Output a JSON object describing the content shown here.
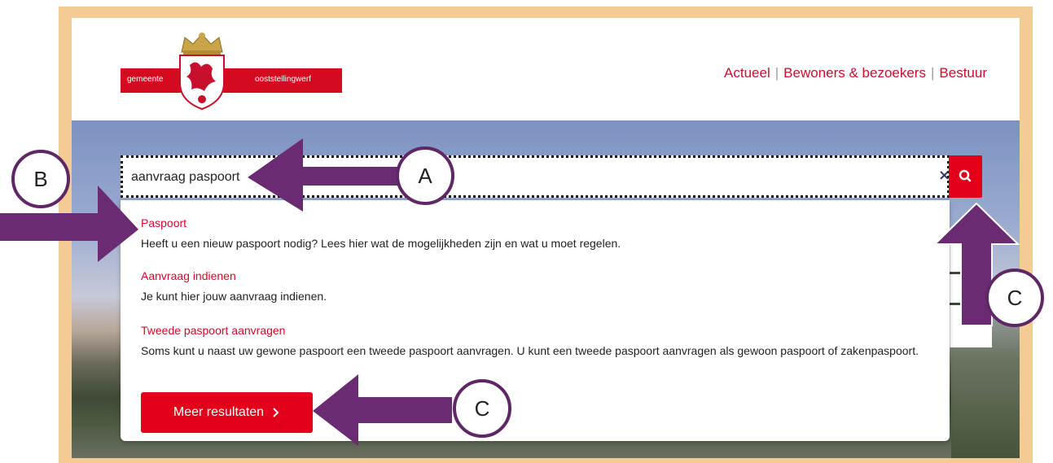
{
  "header": {
    "logo": {
      "text_left": "gemeente",
      "text_right": "ooststellingwerf"
    },
    "nav": [
      {
        "label": "Actueel"
      },
      {
        "label": "Bewoners & bezoekers"
      },
      {
        "label": "Bestuur"
      }
    ],
    "nav_separator": "|"
  },
  "search": {
    "value": "aanvraag paspoort",
    "clear_icon": "close-icon",
    "submit_icon": "search-icon"
  },
  "results": [
    {
      "title": "Paspoort",
      "description": "Heeft u een nieuw paspoort nodig? Lees hier wat de mogelijkheden zijn en wat u moet regelen."
    },
    {
      "title": "Aanvraag indienen",
      "description": "Je kunt hier jouw aanvraag indienen."
    },
    {
      "title": "Tweede paspoort aanvragen",
      "description": "Soms kunt u naast uw gewone paspoort een tweede paspoort aanvragen. U kunt een tweede paspoort aanvragen als gewoon paspoort of zakenpaspoort."
    }
  ],
  "more_results": {
    "label": "Meer resultaten",
    "icon": "chevron-right-icon"
  },
  "annotations": [
    {
      "label": "A"
    },
    {
      "label": "B"
    },
    {
      "label": "C"
    },
    {
      "label": "C"
    }
  ],
  "colors": {
    "brand_red": "#e2001a",
    "link_red": "#d40a2a",
    "frame": "#f5cb94",
    "annotation_purple": "#5f2766"
  }
}
